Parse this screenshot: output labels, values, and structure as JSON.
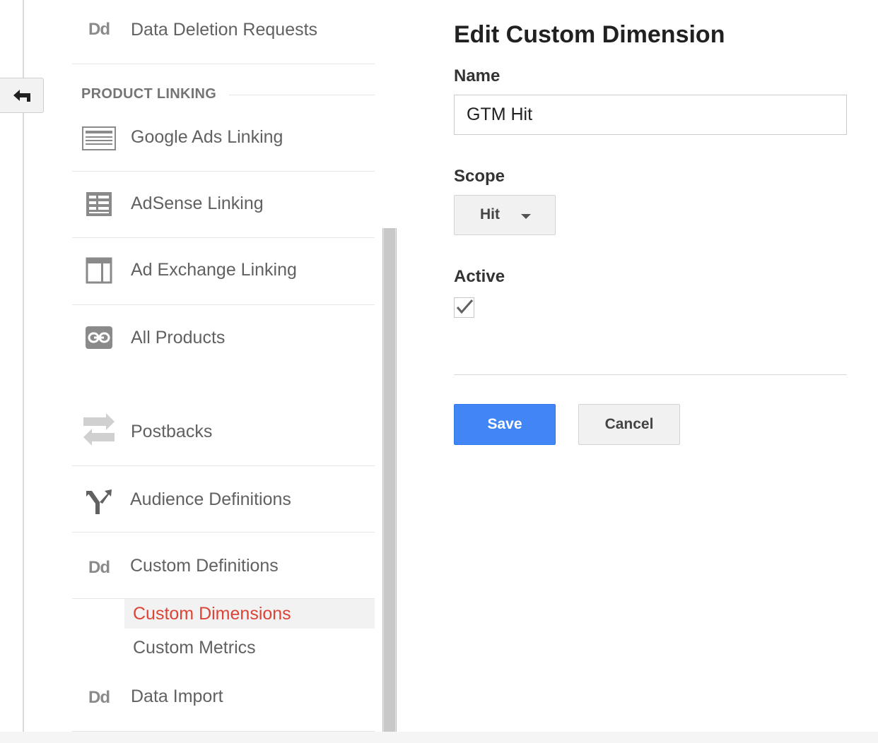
{
  "sidebar": {
    "back_icon": "back-arrow-icon",
    "section_header": "PRODUCT LINKING",
    "items": {
      "data_deletion": {
        "label": "Data Deletion Requests",
        "icon": "Dd"
      },
      "google_ads": {
        "label": "Google Ads Linking",
        "icon": "google-ads-icon"
      },
      "adsense": {
        "label": "AdSense Linking",
        "icon": "adsense-icon"
      },
      "ad_exchange": {
        "label": "Ad Exchange Linking",
        "icon": "ad-exchange-icon"
      },
      "all_products": {
        "label": "All Products",
        "icon": "link-icon"
      },
      "postbacks": {
        "label": "Postbacks",
        "icon": "swap-arrows-icon"
      },
      "audience_definitions": {
        "label": "Audience Definitions",
        "icon": "fork-icon"
      },
      "custom_definitions": {
        "label": "Custom Definitions",
        "icon": "Dd"
      },
      "data_import": {
        "label": "Data Import",
        "icon": "Dd"
      }
    },
    "sub_items": {
      "custom_dimensions": "Custom Dimensions",
      "custom_metrics": "Custom Metrics"
    },
    "active_color": "#db4437"
  },
  "form": {
    "title": "Edit Custom Dimension",
    "name_label": "Name",
    "name_value": "GTM Hit",
    "scope_label": "Scope",
    "scope_value": "Hit",
    "active_label": "Active",
    "active_checked": true,
    "save_label": "Save",
    "cancel_label": "Cancel",
    "save_color": "#4285f4"
  }
}
